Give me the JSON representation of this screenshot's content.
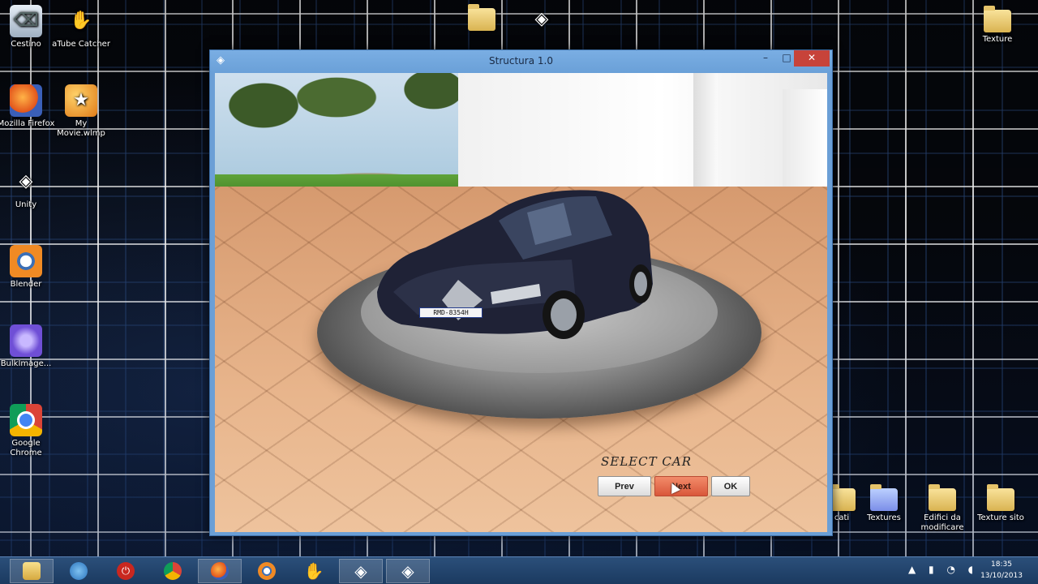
{
  "desktop": {
    "icons_left": [
      {
        "label": "Cestino",
        "icon": "recycle-bin-icon"
      },
      {
        "label": "aTube Catcher",
        "icon": "atube-catcher-icon"
      },
      {
        "label": "Mozilla Firefox",
        "icon": "firefox-icon"
      },
      {
        "label": "My Movie.wlmp",
        "icon": "movie-file-icon"
      },
      {
        "label": "Unity",
        "icon": "unity-icon"
      },
      {
        "label": "Blender",
        "icon": "blender-icon"
      },
      {
        "label": "BulkImage...",
        "icon": "bulkimage-icon"
      },
      {
        "label": "Google Chrome",
        "icon": "chrome-icon"
      }
    ],
    "icons_right": [
      {
        "label": "Texture",
        "icon": "folder-icon"
      },
      {
        "label": "cati",
        "icon": "folder-icon"
      },
      {
        "label": "Textures",
        "icon": "folder-icon"
      },
      {
        "label": "Edifici da modificare",
        "icon": "folder-icon"
      },
      {
        "label": "Texture sito",
        "icon": "folder-icon"
      }
    ]
  },
  "window": {
    "title": "Structura 1.0",
    "minimize": "–",
    "maximize": "□",
    "close": "✕"
  },
  "scene": {
    "plate": "RMD-8354H",
    "select_label": "SELECT CAR",
    "prev_label": "Prev",
    "next_label": "Next",
    "ok_label": "OK"
  },
  "taskbar": {
    "items": [
      "file-explorer-icon",
      "network-icon",
      "power-icon",
      "chrome-icon",
      "firefox-icon",
      "blender-icon",
      "atube-catcher-icon",
      "unity-icon",
      "unity-icon"
    ],
    "time": "18:35",
    "date": "13/10/2013"
  }
}
